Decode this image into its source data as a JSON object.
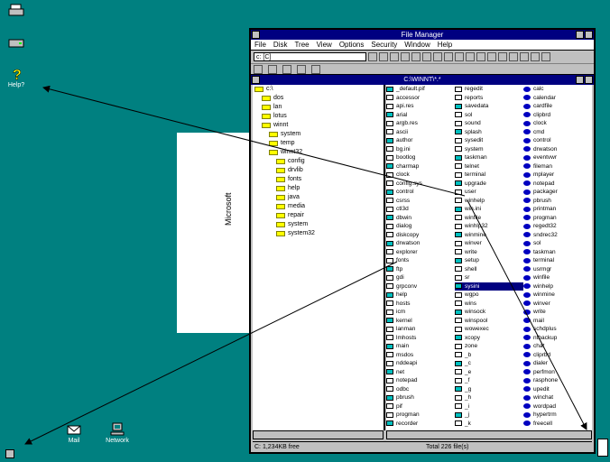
{
  "desktop_icons": [
    {
      "label": "",
      "icon": "printer-icon"
    },
    {
      "label": "",
      "icon": "drive-icon"
    },
    {
      "label": "Help?",
      "icon": "help-icon"
    },
    {
      "label": "Mail",
      "icon": "mail-icon"
    },
    {
      "label": "Network",
      "icon": "network-icon"
    }
  ],
  "window": {
    "title": "File Manager",
    "menu": [
      "File",
      "Disk",
      "Tree",
      "View",
      "Options",
      "Security",
      "Window",
      "Help"
    ],
    "drive_select": "c: [C]",
    "child_title": "C:\\WINNT\\*.*",
    "status_left": "C: 1,234KB free",
    "status_right": "Total 226 file(s)"
  },
  "tree_items": [
    "c:\\",
    "dos",
    "lan",
    "lotus",
    "winnt",
    "system",
    "temp",
    "winnt32",
    "config",
    "drvlib",
    "fonts",
    "help",
    "java",
    "media",
    "repair",
    "system",
    "system32"
  ],
  "file_columns": [
    [
      "_default.pif",
      "accessor",
      "api.res",
      "arial",
      "argb.res",
      "ascii",
      "author",
      "bg.ini",
      "bootlog",
      "charmap",
      "clock",
      "config.sys",
      "control",
      "csrss",
      "ctl3d",
      "dbwin",
      "dialog",
      "diskcopy",
      "drwatson",
      "explorer",
      "fonts",
      "ftp",
      "gdi",
      "grpconv",
      "help",
      "hosts",
      "icm",
      "kernel",
      "lanman",
      "lmhosts",
      "main",
      "msdos",
      "nddeapi",
      "net",
      "notepad",
      "odbc",
      "pbrush",
      "pif",
      "progman",
      "recorder"
    ],
    [
      "regedit",
      "reports",
      "savedata",
      "sol",
      "sound",
      "splash",
      "sysedit",
      "system",
      "taskman",
      "telnet",
      "terminal",
      "upgrade",
      "user",
      "winhelp",
      "win.ini",
      "winfile",
      "winhlp32",
      "winmine",
      "winver",
      "write",
      "setup",
      "shell",
      "sr",
      "sysini",
      "wgpo",
      "wins",
      "winsock",
      "winspool",
      "wowexec",
      "xcopy",
      "zone",
      "_b",
      "_c",
      "_e",
      "_f",
      "_g",
      "_h",
      "_i",
      "_j",
      "_k"
    ],
    [
      "calc",
      "calendar",
      "cardfile",
      "clipbrd",
      "clock",
      "cmd",
      "control",
      "drwatson",
      "eventvwr",
      "fileman",
      "mplayer",
      "notepad",
      "packager",
      "pbrush",
      "printman",
      "progman",
      "regedt32",
      "sndrec32",
      "sol",
      "taskman",
      "terminal",
      "usrmgr",
      "winfile",
      "winhelp",
      "winmine",
      "winver",
      "write",
      "mail",
      "schdplus",
      "ntbackup",
      "chat",
      "cliprbd",
      "dialer",
      "perfmon",
      "rasphone",
      "upedit",
      "winchat",
      "wordpad",
      "hypertrm",
      "freecell"
    ]
  ],
  "selected_file": "sysini",
  "doc_text": "Microsoft"
}
